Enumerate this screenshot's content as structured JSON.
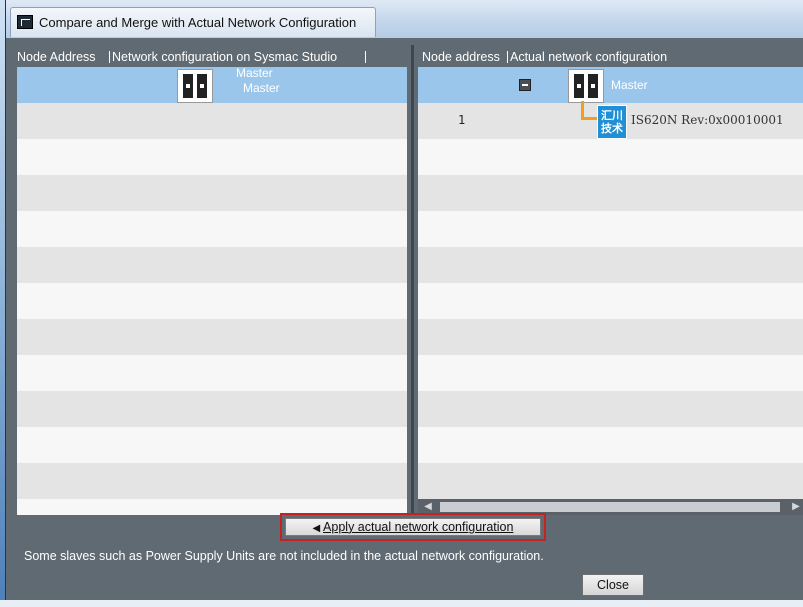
{
  "window": {
    "title": "Compare and Merge with Actual Network Configuration"
  },
  "left_panel": {
    "header_node_address": "Node Address",
    "header_config": "Network configuration on Sysmac Studio",
    "master_label_top": "Master",
    "master_label_bottom": "Master"
  },
  "right_panel": {
    "header_node_address": "Node address",
    "header_config": "Actual network configuration",
    "master_label": "Master",
    "slave": {
      "node_address": "1",
      "logo_line1": "汇川",
      "logo_line2": "技术",
      "name": "IS620N Rev:0x00010001"
    }
  },
  "footer": {
    "apply_button_label": "Apply actual network configuration",
    "message": "Some slaves such as Power Supply Units are not included in the actual network configuration.",
    "close_button_label": "Close"
  },
  "colors": {
    "selected_row": "#9ac6ec",
    "chrome": "#5f6a72",
    "highlight_border": "#c52222",
    "link_line": "#f0a020",
    "logo_bg": "#1f8fd6"
  }
}
